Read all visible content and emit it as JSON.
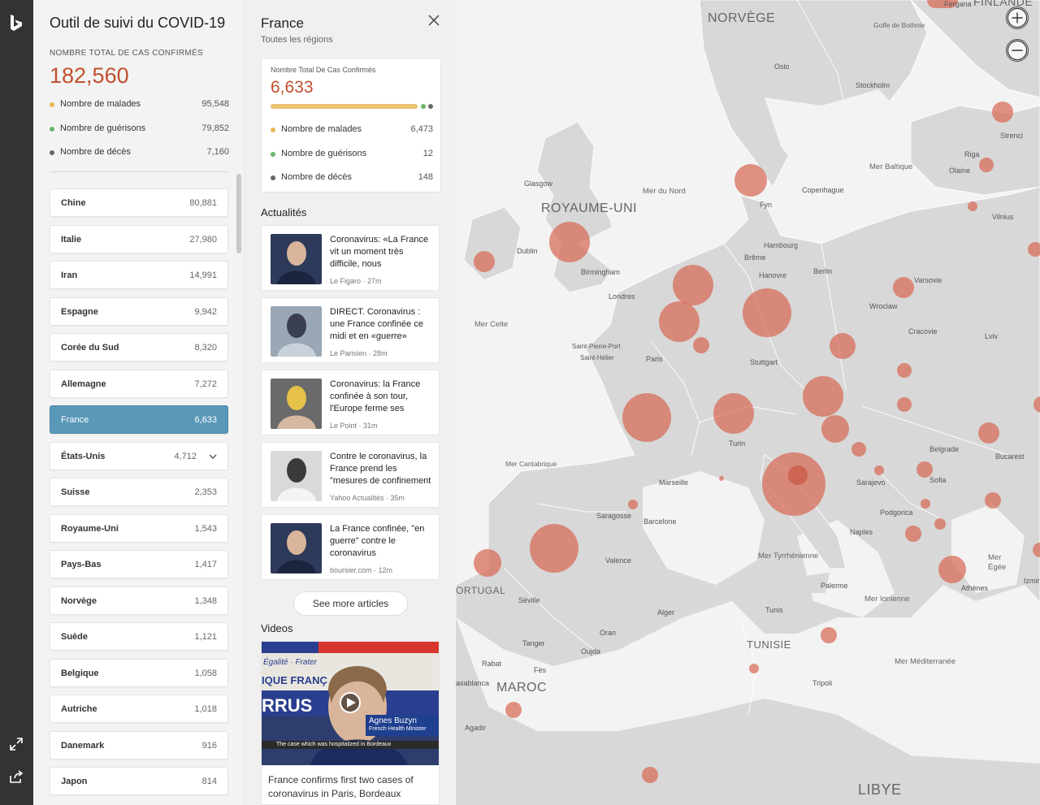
{
  "app": {
    "title": "Outil de suivi du COVID-19",
    "total_label": "NOMBRE TOTAL DE CAS CONFIRMÉS",
    "total_value": "182,560",
    "stats": [
      {
        "label": "Nombre de malades",
        "value": "95,548",
        "color": "#e9b95c"
      },
      {
        "label": "Nombre de guérisons",
        "value": "79,852",
        "color": "#6db56d"
      },
      {
        "label": "Nombre de décès",
        "value": "7,160",
        "color": "#666666"
      }
    ]
  },
  "countries": [
    {
      "name": "Chine",
      "value": "80,881"
    },
    {
      "name": "Italie",
      "value": "27,980"
    },
    {
      "name": "Iran",
      "value": "14,991"
    },
    {
      "name": "Espagne",
      "value": "9,942"
    },
    {
      "name": "Corée du Sud",
      "value": "8,320"
    },
    {
      "name": "Allemagne",
      "value": "7,272"
    },
    {
      "name": "France",
      "value": "6,633",
      "selected": true
    },
    {
      "name": "États-Unis",
      "value": "4,712",
      "expandable": true
    },
    {
      "name": "Suisse",
      "value": "2,353"
    },
    {
      "name": "Royaume-Uni",
      "value": "1,543"
    },
    {
      "name": "Pays-Bas",
      "value": "1,417"
    },
    {
      "name": "Norvège",
      "value": "1,348"
    },
    {
      "name": "Suède",
      "value": "1,121"
    },
    {
      "name": "Belgique",
      "value": "1,058"
    },
    {
      "name": "Autriche",
      "value": "1,018"
    },
    {
      "name": "Danemark",
      "value": "916"
    },
    {
      "name": "Japon",
      "value": "814"
    }
  ],
  "detail": {
    "title": "France",
    "subtitle": "Toutes les régions",
    "card_label": "Nombre Total De Cas Confirmés",
    "card_value": "6,633",
    "rows": [
      {
        "label": "Nombre de malades",
        "value": "6,473",
        "color": "#e9b95c"
      },
      {
        "label": "Nombre de guérisons",
        "value": "12",
        "color": "#6db56d"
      },
      {
        "label": "Nombre de décès",
        "value": "148",
        "color": "#666666"
      }
    ],
    "news_heading": "Actualités",
    "news": [
      {
        "headline": "Coronavirus: «La France vit un moment très difficile, nous",
        "source": "Le Figaro",
        "age": "27m"
      },
      {
        "headline": "DIRECT. Coronavirus : une France confinée ce midi et en «guerre»",
        "source": "Le Parisien",
        "age": "28m"
      },
      {
        "headline": "Coronavirus: la France confinée à son tour, l'Europe ferme ses",
        "source": "Le Point",
        "age": "31m"
      },
      {
        "headline": "Contre le coronavirus, la France prend les \"mesures de confinement",
        "source": "Yahoo Actualités",
        "age": "35m"
      },
      {
        "headline": "La France confinée, \"en guerre\" contre le coronavirus",
        "source": "boursier.com",
        "age": "12m"
      }
    ],
    "more_label": "See more articles",
    "videos_heading": "Videos",
    "video": {
      "caption": "France confirms first two cases of coronavirus in Paris, Bordeaux",
      "overlay_name": "Agnes Buzyn",
      "overlay_role": "French Health Minister",
      "overlay_ticker": "The case which was hospitalized in Bordeaux",
      "banner_text": "Égalité · Frater",
      "banner_text2": "IQUE FRANÇ",
      "banner_text3": "RRUS"
    }
  },
  "map": {
    "labels": {
      "countries": [
        "NORVÈGE",
        "ROYAUME-UNI",
        "TUNISIE",
        "MAROC",
        "LIBYE",
        "FINLANDE",
        "ORTUGAL"
      ],
      "seas": [
        "Mer du Nord",
        "Mer Baltique",
        "Mer Celte",
        "Mer Cantabrique",
        "Mer Tyrrhénienne",
        "Mer Ionienne",
        "Mer Méditerranée",
        "Mer Égée",
        "Golfe de Bothnie"
      ],
      "cities": [
        "Oslo",
        "Stockholm",
        "Riga",
        "Olaine",
        "Strenci",
        "Vilnius",
        "Glasgow",
        "Copenhague",
        "Fyn",
        "Hambourg",
        "Brême",
        "Hanovre",
        "Berlin",
        "Varsovie",
        "Dublin",
        "Birmingham",
        "Londres",
        "Wroclaw",
        "Cracovie",
        "Lviv",
        "Saint-Pierre-Port",
        "Saint-Hélier",
        "Paris",
        "Stuttgart",
        "Turin",
        "Belgrade",
        "Bucarest",
        "Sarajevo",
        "Sofia",
        "Podgorica",
        "Marseille",
        "Saragosse",
        "Barcelone",
        "Naples",
        "Valence",
        "Séville",
        "Palerme",
        "Athènes",
        "Alger",
        "Tunis",
        "Oran",
        "Tanger",
        "Oujda",
        "Rabat",
        "Fès",
        "Tripoli",
        "Agadir",
        "asablanca",
        "Izmir",
        "Fergana"
      ]
    },
    "zoom_in": "+",
    "zoom_out": "−"
  }
}
